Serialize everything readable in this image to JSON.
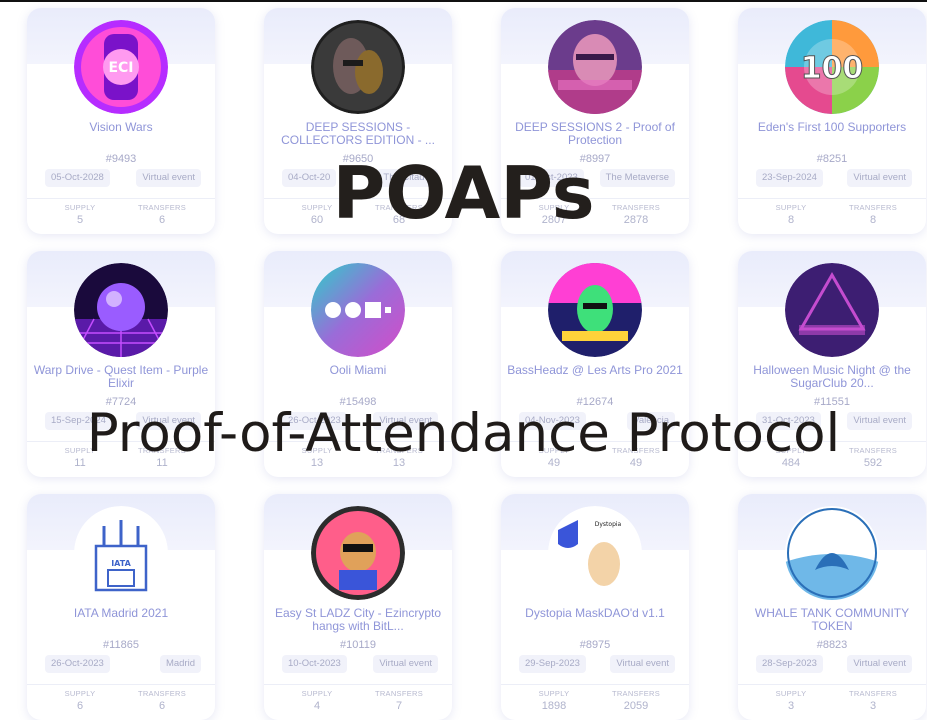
{
  "overlay": {
    "title": "POAPs",
    "subtitle": "Proof-of-Attendance Protocol"
  },
  "labels": {
    "supply": "SUPPLY",
    "transfers": "TRANSFERS"
  },
  "cards": [
    {
      "title": "Vision Wars",
      "id": "#9493",
      "date": "05-Oct-2028",
      "location": "Virtual event",
      "supply": "5",
      "transfers": "6",
      "icon": "eci-badge-icon",
      "colors": [
        "#ff4dd8",
        "#b62cff"
      ]
    },
    {
      "title": "DEEP SESSIONS - COLLECTORS EDITION - ...",
      "id": "#9650",
      "date": "04-Oct-20",
      "location": "The Citadel",
      "supply": "60",
      "transfers": "68",
      "icon": "deep-sessions-mask-icon",
      "colors": [
        "#2a2a2a",
        "#6b3b4f"
      ]
    },
    {
      "title": "DEEP SESSIONS 2 - Proof of Protection",
      "id": "#8997",
      "date": "01-Oct-2023",
      "location": "The Metaverse",
      "supply": "2807",
      "transfers": "2878",
      "icon": "protection-face-icon",
      "colors": [
        "#d15fa6",
        "#6b3c8c"
      ]
    },
    {
      "title": "Eden's First 100 Supporters",
      "id": "#8251",
      "date": "23-Sep-2024",
      "location": "Virtual event",
      "supply": "8",
      "transfers": "8",
      "icon": "hundred-badge-icon",
      "colors": [
        "#ff9a3c",
        "#3fb8d9"
      ]
    },
    {
      "title": "Warp Drive - Quest Item - Purple Elixir",
      "id": "#7724",
      "date": "15-Sep-2024",
      "location": "Virtual event",
      "supply": "11",
      "transfers": "11",
      "icon": "purple-orb-icon",
      "colors": [
        "#7b2cf0",
        "#2a0e5c"
      ]
    },
    {
      "title": "Ooli Miami",
      "id": "#15498",
      "date": "26-Oct-2023",
      "location": "Virtual event",
      "supply": "13",
      "transfers": "13",
      "icon": "ooli-shapes-icon",
      "colors": [
        "#2bd0c9",
        "#d44cc8"
      ]
    },
    {
      "title": "BassHeadz @ Les Arts Pro 2021",
      "id": "#12674",
      "date": "04-Nov-2023",
      "location": "Valencia",
      "supply": "49",
      "transfers": "49",
      "icon": "green-head-icon",
      "colors": [
        "#ff3fd4",
        "#1f1f6b"
      ]
    },
    {
      "title": "Halloween Music Night @ the SugarClub 20...",
      "id": "#11551",
      "date": "31-Oct-2023",
      "location": "Virtual event",
      "supply": "484",
      "transfers": "592",
      "icon": "metaverse-music-fest-icon",
      "colors": [
        "#3d1e72",
        "#c44ccf"
      ]
    },
    {
      "title": "IATA Madrid 2021",
      "id": "#11865",
      "date": "26-Oct-2023",
      "location": "Madrid",
      "supply": "6",
      "transfers": "6",
      "icon": "iata-building-icon",
      "colors": [
        "#ffffff",
        "#3e63c9"
      ]
    },
    {
      "title": "Easy St LADZ City - Ezincrypto hangs with BitL...",
      "id": "#10119",
      "date": "10-Oct-2023",
      "location": "Virtual event",
      "supply": "4",
      "transfers": "7",
      "icon": "cool-dog-icon",
      "colors": [
        "#ff5e8a",
        "#2c2c2c"
      ]
    },
    {
      "title": "Dystopia MaskDAO'd v1.1",
      "id": "#8975",
      "date": "29-Sep-2023",
      "location": "Virtual event",
      "supply": "1898",
      "transfers": "2059",
      "icon": "dystopia-mask-icon",
      "colors": [
        "#ffffff",
        "#3a55d9"
      ]
    },
    {
      "title": "WHALE TANK COMMUNITY TOKEN",
      "id": "#8823",
      "date": "28-Sep-2023",
      "location": "Virtual event",
      "supply": "3",
      "transfers": "3",
      "icon": "whale-tail-icon",
      "colors": [
        "#6fb8e8",
        "#ffffff"
      ]
    }
  ]
}
